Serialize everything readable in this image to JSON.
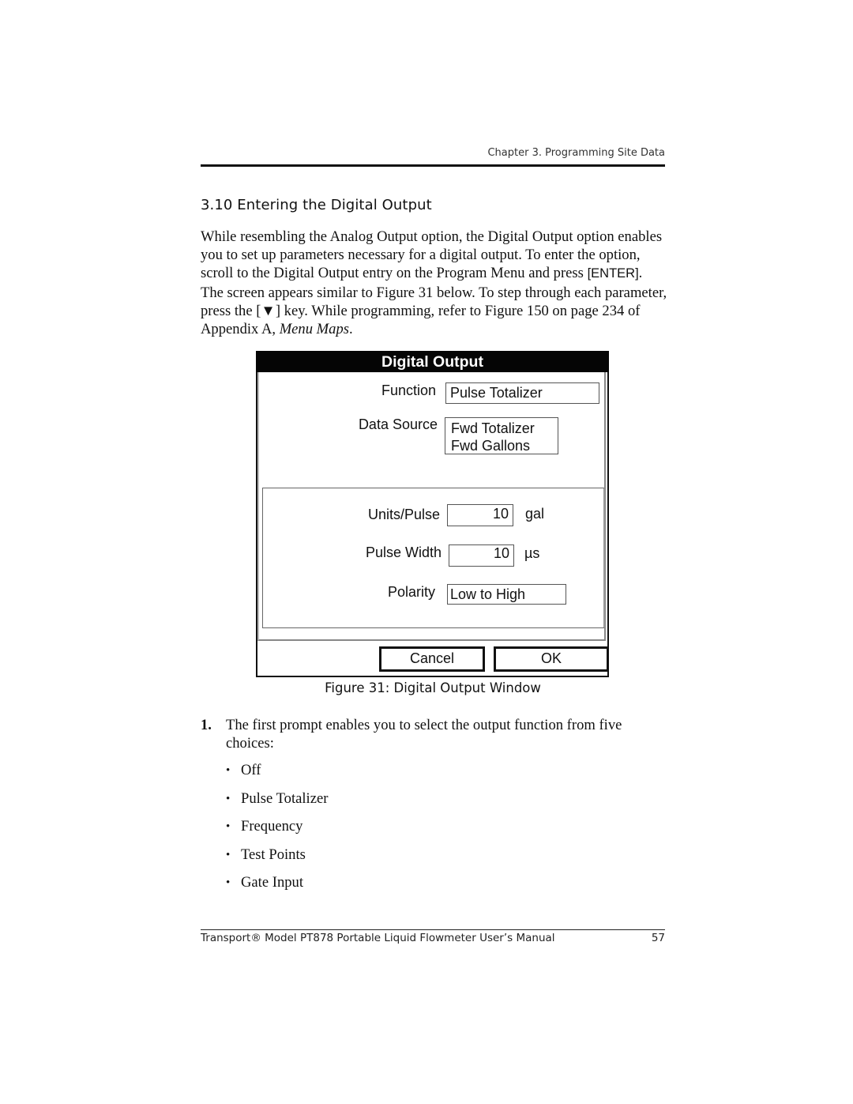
{
  "header": {
    "running_title": "Chapter 3. Programming Site Data"
  },
  "section": {
    "title": "3.10 Entering the Digital Output"
  },
  "intro": {
    "part1": "While resembling the Analog Output option, the Digital Output option enables you to set up parameters necessary for a digital output. To enter the option, scroll to the Digital Output entry on the Program Menu and press ",
    "enter_key": "[ENTER]",
    "part2": ". The screen appears similar to Figure 31 below. To step through each parameter, press the [",
    "down_key_icon": "▼",
    "part3": "] key. While programming, refer to Figure 150 on page 234 of Appendix A, ",
    "menu_maps": "Menu Maps",
    "part4": "."
  },
  "dialog": {
    "title": "Digital Output",
    "function": {
      "label": "Function",
      "value": "Pulse Totalizer"
    },
    "data_source": {
      "label": "Data Source",
      "value_line1": "Fwd Totalizer",
      "value_line2": "Fwd Gallons"
    },
    "units_per_pulse": {
      "label": "Units/Pulse",
      "value": "10",
      "unit": "gal"
    },
    "pulse_width": {
      "label": "Pulse Width",
      "value": "10",
      "unit": "µs"
    },
    "polarity": {
      "label": "Polarity",
      "value": "Low to High"
    },
    "buttons": {
      "cancel": "Cancel",
      "ok": "OK"
    }
  },
  "figure": {
    "caption": "Figure 31: Digital Output Window"
  },
  "steps": [
    {
      "number": "1.",
      "text": "The first prompt enables you to select the output function from five choices:",
      "choices": [
        "Off",
        "Pulse Totalizer",
        "Frequency",
        "Test Points",
        "Gate Input"
      ],
      "bullet": "•"
    }
  ],
  "footer": {
    "manual_title": "Transport® Model PT878 Portable Liquid Flowmeter User’s Manual",
    "page_number": "57"
  }
}
